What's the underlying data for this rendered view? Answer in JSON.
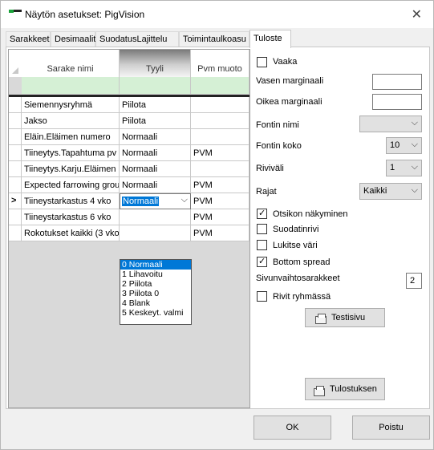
{
  "window": {
    "title": "Näytön asetukset: PigVision",
    "close_label": "✕"
  },
  "tabs": [
    {
      "label": "Sarakkeet"
    },
    {
      "label": "Desimaalit"
    },
    {
      "label": "SuodatusLajittelu"
    },
    {
      "label": "Toimintaulkoasu"
    },
    {
      "label": "Tuloste"
    }
  ],
  "grid": {
    "columns": [
      "Sarake nimi",
      "Tyyli",
      "Pvm muoto"
    ],
    "rows": [
      {
        "name": "Siemennysryhmä",
        "style": "Piilota",
        "date": ""
      },
      {
        "name": "Jakso",
        "style": "Piilota",
        "date": ""
      },
      {
        "name": "Eläin.Eläimen numero",
        "style": "Normaali",
        "date": ""
      },
      {
        "name": "Tiineytys.Tapahtuma pv",
        "style": "Normaali",
        "date": "PVM"
      },
      {
        "name": "Tiineytys.Karju.Eläimen",
        "style": "Normaali",
        "date": ""
      },
      {
        "name": "Expected farrowing grou",
        "style": "Normaali",
        "date": "PVM"
      },
      {
        "name": "Tiineystarkastus 4 vko",
        "style": "Normaali",
        "date": "PVM",
        "indicator": ">"
      },
      {
        "name": "Tiineystarkastus 6 vko",
        "style": "",
        "date": "PVM"
      },
      {
        "name": "Rokotukset kaikki (3 vko",
        "style": "",
        "date": "PVM"
      }
    ],
    "dropdown_options": [
      "0 Normaali",
      "1 Lihavoitu",
      "2 Piilota",
      "3 Piilota 0",
      "4 Blank",
      "5 Keskeyt. valmi"
    ]
  },
  "print": {
    "vaaka_label": "Vaaka",
    "left_margin_label": "Vasen marginaali",
    "right_margin_label": "Oikea marginaali",
    "font_name_label": "Fontin nimi",
    "font_name_value": "",
    "font_size_label": "Fontin koko",
    "font_size_value": "10",
    "line_spacing_label": "Riviväli",
    "line_spacing_value": "1",
    "borders_label": "Rajat",
    "borders_value": "Kaikki",
    "header_visible_label": "Otsikon näkyminen",
    "filter_row_label": "Suodatinrivi",
    "lock_color_label": "Lukitse väri",
    "bottom_spread_label": "Bottom spread",
    "page_break_cols_label": "Sivunvaihtosarakkeet",
    "page_break_cols_value": "2",
    "group_lines_label": "Rivit ryhmässä",
    "test_page_label": "Testisivu",
    "print_button_label": "Tulostuksen"
  },
  "footer": {
    "ok_label": "OK",
    "cancel_label": "Poistu"
  }
}
